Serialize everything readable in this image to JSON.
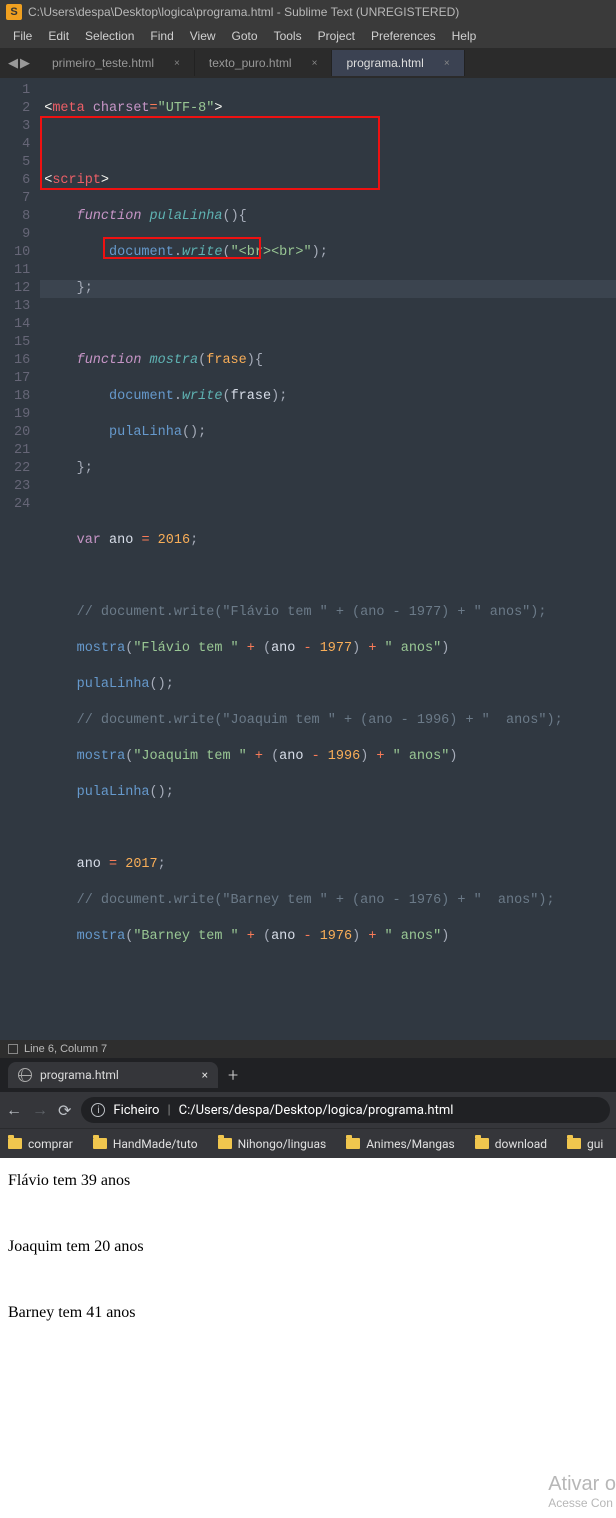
{
  "sublime": {
    "title": "C:\\Users\\despa\\Desktop\\logica\\programa.html - Sublime Text (UNREGISTERED)",
    "menu": [
      "File",
      "Edit",
      "Selection",
      "Find",
      "View",
      "Goto",
      "Tools",
      "Project",
      "Preferences",
      "Help"
    ],
    "nav_left": "◀",
    "nav_right": "▶",
    "tabs": [
      {
        "label": "primeiro_teste.html",
        "close": "×"
      },
      {
        "label": "texto_puro.html",
        "close": "×"
      },
      {
        "label": "programa.html",
        "close": "×",
        "active": true
      }
    ],
    "lines": {
      "count": 24
    },
    "code": {
      "meta_open": "<",
      "meta_tag": "meta",
      "meta_attr": "charset",
      "meta_eq": "=",
      "meta_val": "\"UTF-8\"",
      "meta_close": ">",
      "script_open_lt": "<",
      "script_tag": "script",
      "gt": ">",
      "kw_function": "function",
      "fn_pula": "pulaLinha",
      "paren_open": "(",
      "paren_close": ")",
      "brace_open": "{",
      "brace_close": "}",
      "document": "document",
      "dot": ".",
      "write": "write",
      "br_str": "\"<br><br>\"",
      "semi": ";",
      "fn_mostra": "mostra",
      "param_frase": "frase",
      "frase_arg": "frase",
      "pulaLinha_call": "pulaLinha",
      "kw_var": "var",
      "ano": "ano",
      "eq": " = ",
      "y2016": "2016",
      "com15": "// document.write(\"Flávio tem \" + (ano - 1977) + \" anos\");",
      "mostra_call": "mostra",
      "str_flavio": "\"Flávio tem \"",
      "plus": " + ",
      "paropen": "(",
      "y1977": "1977",
      "minus": " - ",
      "parclose": ")",
      "str_anos": "\" anos\"",
      "com18": "// document.write(\"Joaquim tem \" + (ano - 1996) + \"  anos\");",
      "str_joaquim": "\"Joaquim tem \"",
      "y1996": "1996",
      "y2017": "2017",
      "com23": "// document.write(\"Barney tem \" + (ano - 1976) + \"  anos\");",
      "str_barney": "\"Barney tem \"",
      "y1976": "1976"
    },
    "status": "Line 6, Column 7"
  },
  "chrome": {
    "tab_title": "programa.html",
    "tab_close": "×",
    "newtab": "+",
    "back": "←",
    "forward": "→",
    "reload": "⟳",
    "addr_label": "Ficheiro",
    "addr_path": "C:/Users/despa/Desktop/logica/programa.html",
    "info": "i",
    "bookmarks": [
      "comprar",
      "HandMade/tuto",
      "Nihongo/linguas",
      "Animes/Mangas",
      "download",
      "gui"
    ]
  },
  "page": {
    "line1": "Flávio tem 39 anos",
    "line2": "Joaquim tem 20 anos",
    "line3": "Barney tem 41 anos"
  },
  "watermark": {
    "l1": "Ativar o",
    "l2": "Acesse Con"
  }
}
